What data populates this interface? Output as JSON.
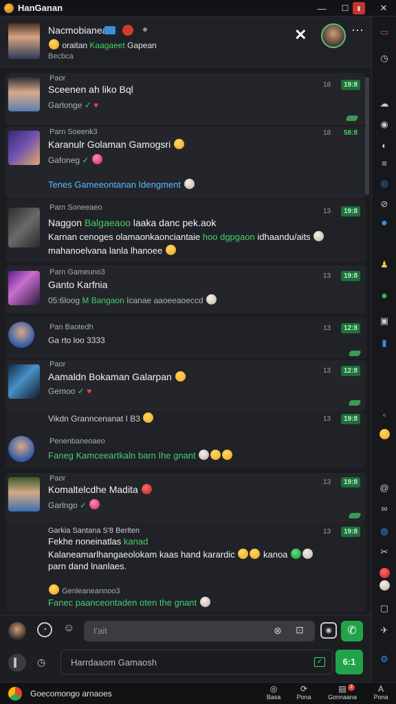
{
  "window": {
    "title": "HanGanan",
    "min": "—",
    "max": "☐",
    "close": "✕"
  },
  "header": {
    "name": "Nacmobianean",
    "line2": "oraitan",
    "line2_green": "Kaagaeet",
    "line2_rest": "Gapean",
    "line3": "Becbca"
  },
  "messages": [
    {
      "label": "Paor",
      "title": "Sceenen ah liko Bql",
      "sub": "Garlonge",
      "time": "18",
      "badge": "19:8"
    },
    {
      "label": "Parn Soeenk3",
      "title": "Karanulr Golaman Gamogsri",
      "sub": "Gafoneg",
      "note": "Tenes Gameeontanan Idengment",
      "time": "18",
      "badge": "58:8"
    },
    {
      "label": "Parn Soneeaeo",
      "title_a": "Naggon",
      "title_green": "Balgaeaoo",
      "title_b": "laaka danc pek.aok",
      "line2_a": "Karnan cenoges olamaonkaonciantaie",
      "line2_green": "hoo dgpgaon",
      "line2_b": "idhaandu/aits",
      "line3": "mahanoelvana lanla lhanoee",
      "time": "13",
      "badge": "19:8"
    },
    {
      "label": "Parn Gameuno3",
      "title": "Ganto Karfnia",
      "sub": "05:6loog",
      "sub_b": "M",
      "sub_green": "Bangaon",
      "sub_c": "Icanae aaoeeaoeccd",
      "time": "13",
      "badge": "19:8"
    },
    {
      "label": "Pan Baotedh",
      "title": "Ga rto loo 3333",
      "time": "13",
      "badge": "12:8"
    },
    {
      "label": "Paor",
      "title": "Aamaldn Bokaman Galarpan",
      "sub": "Gemoo",
      "time": "13",
      "badge": "12:8"
    },
    {
      "label": "Vikdn Granncenanat I",
      "label_b": "B3",
      "label2": "Penenbaneoaeo",
      "note": "Faneg Kamceeartkaln barn Ihe gnant",
      "time": "13",
      "badge": "19:8"
    },
    {
      "label": "Paor",
      "title": "Komaltelcdhe Madita",
      "sub": "Garlngo",
      "time": "13",
      "badge": "19:8"
    },
    {
      "label": "Garkia Santana",
      "label_b": "S'8",
      "label_c": "Berlten",
      "line1_a": "Fekhe noneinatlas",
      "line1_green": "kanad",
      "line2": "Kalaneamarlhangaeolokam kaas hand karardic",
      "line2_b": "kanoa",
      "line3": "parn dand lnanlaes.",
      "sub2": "Genleaneannoo3",
      "note": "Fanec paanceontaden oten the gnant",
      "time": "13",
      "badge": "19:8"
    }
  ],
  "composer": {
    "input1_placeholder": "I'ait",
    "input2_placeholder": "Harrdaaom Gamaosh",
    "send_label": "6:1"
  },
  "taskbar": {
    "app_label": "Goecomongo arnaoes",
    "tab1": "Basa",
    "tab2": "Pona",
    "tab3": "Gonnaana",
    "tab4": "Pona",
    "tab3_badge": "2"
  },
  "colors": {
    "accent_green": "#1f6f3a",
    "send_green": "#22a34b"
  },
  "icons": [
    "app-icon",
    "close-icon",
    "more-icon",
    "check-icon",
    "heart-icon",
    "mic-icon",
    "emoji-icon",
    "attach-icon",
    "camera-icon",
    "send-icon"
  ]
}
